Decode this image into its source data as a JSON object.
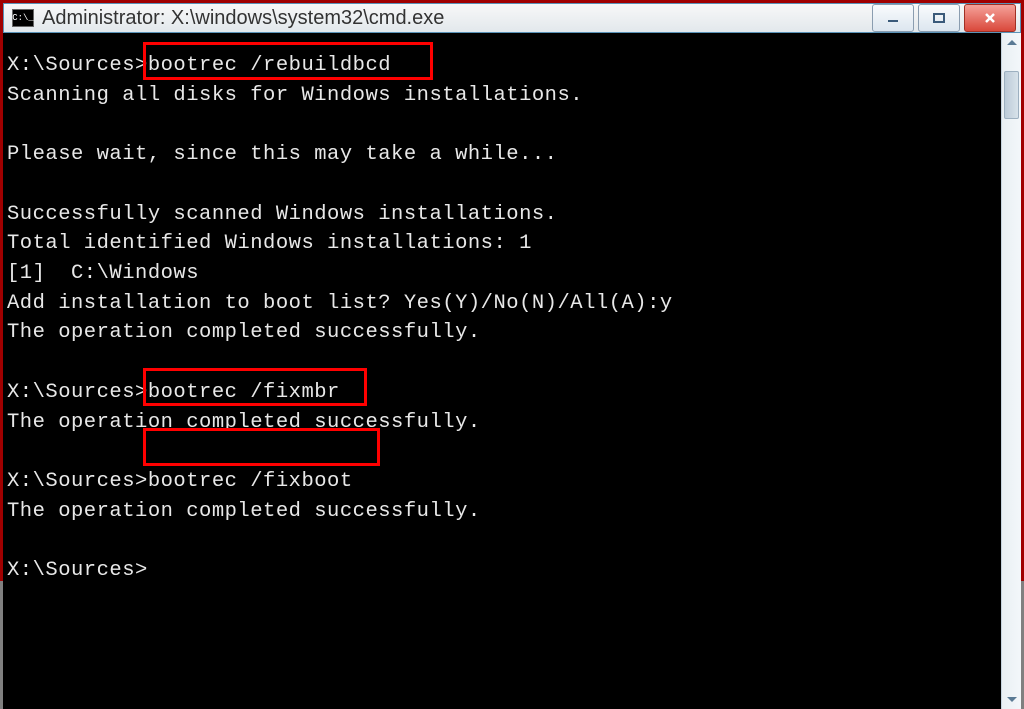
{
  "window": {
    "icon_text": "C:\\_",
    "title": "Administrator: X:\\windows\\system32\\cmd.exe"
  },
  "terminal": {
    "prompt1": "X:\\Sources>",
    "cmd1": "bootrec /rebuildbcd",
    "line2": "Scanning all disks for Windows installations.",
    "line3": "",
    "line4": "Please wait, since this may take a while...",
    "line5": "",
    "line6": "Successfully scanned Windows installations.",
    "line7": "Total identified Windows installations: 1",
    "line8": "[1]  C:\\Windows",
    "line9": "Add installation to boot list? Yes(Y)/No(N)/All(A):y",
    "line10": "The operation completed successfully.",
    "line11": "",
    "prompt2": "X:\\Sources>",
    "cmd2": "bootrec /fixmbr",
    "line13": "The operation completed successfully.",
    "line14": "",
    "prompt3": "X:\\Sources>",
    "cmd3": "bootrec /fixboot",
    "line16": "The operation completed successfully.",
    "line17": "",
    "prompt4": "X:\\Sources>"
  }
}
